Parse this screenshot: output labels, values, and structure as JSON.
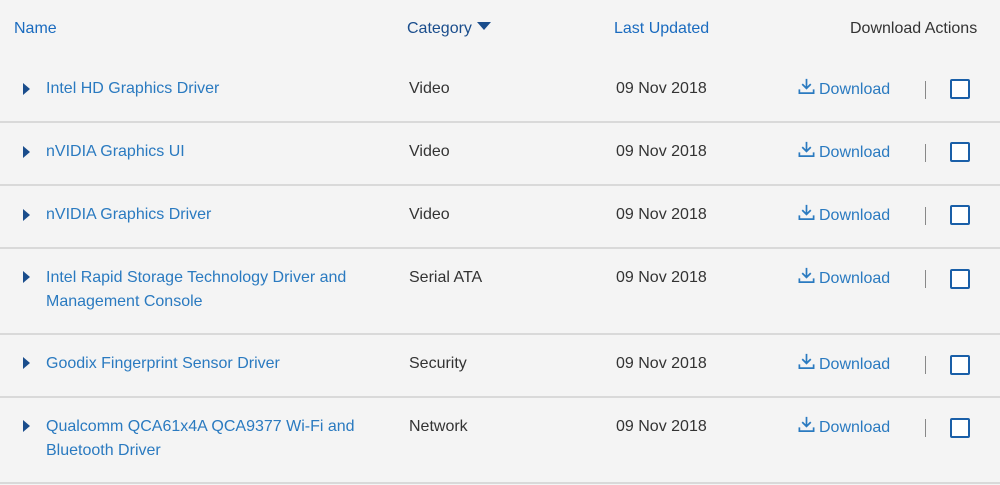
{
  "header": {
    "name": "Name",
    "category": "Category",
    "last_updated": "Last Updated",
    "download_actions": "Download Actions"
  },
  "colors": {
    "link": "#2a7ac0",
    "header_link": "#1a6bbf",
    "sorted_header": "#1a4d8c",
    "text": "#333333",
    "divider": "#d9d9d9",
    "background": "#f4f4f4"
  },
  "icons": {
    "sort": "caret-down-icon",
    "expand": "caret-right-icon",
    "download": "download-icon"
  },
  "rows": [
    {
      "name": "Intel HD Graphics Driver",
      "category": "Video",
      "date": "09 Nov 2018",
      "download_label": "Download"
    },
    {
      "name": "nVIDIA Graphics UI",
      "category": "Video",
      "date": "09 Nov 2018",
      "download_label": "Download"
    },
    {
      "name": "nVIDIA Graphics Driver",
      "category": "Video",
      "date": "09 Nov 2018",
      "download_label": "Download"
    },
    {
      "name": "Intel Rapid Storage Technology Driver and Management Console",
      "category": "Serial ATA",
      "date": "09 Nov 2018",
      "download_label": "Download"
    },
    {
      "name": "Goodix Fingerprint Sensor Driver",
      "category": "Security",
      "date": "09 Nov 2018",
      "download_label": "Download"
    },
    {
      "name": "Qualcomm QCA61x4A QCA9377 Wi-Fi and Bluetooth Driver",
      "category": "Network",
      "date": "09 Nov 2018",
      "download_label": "Download"
    }
  ]
}
